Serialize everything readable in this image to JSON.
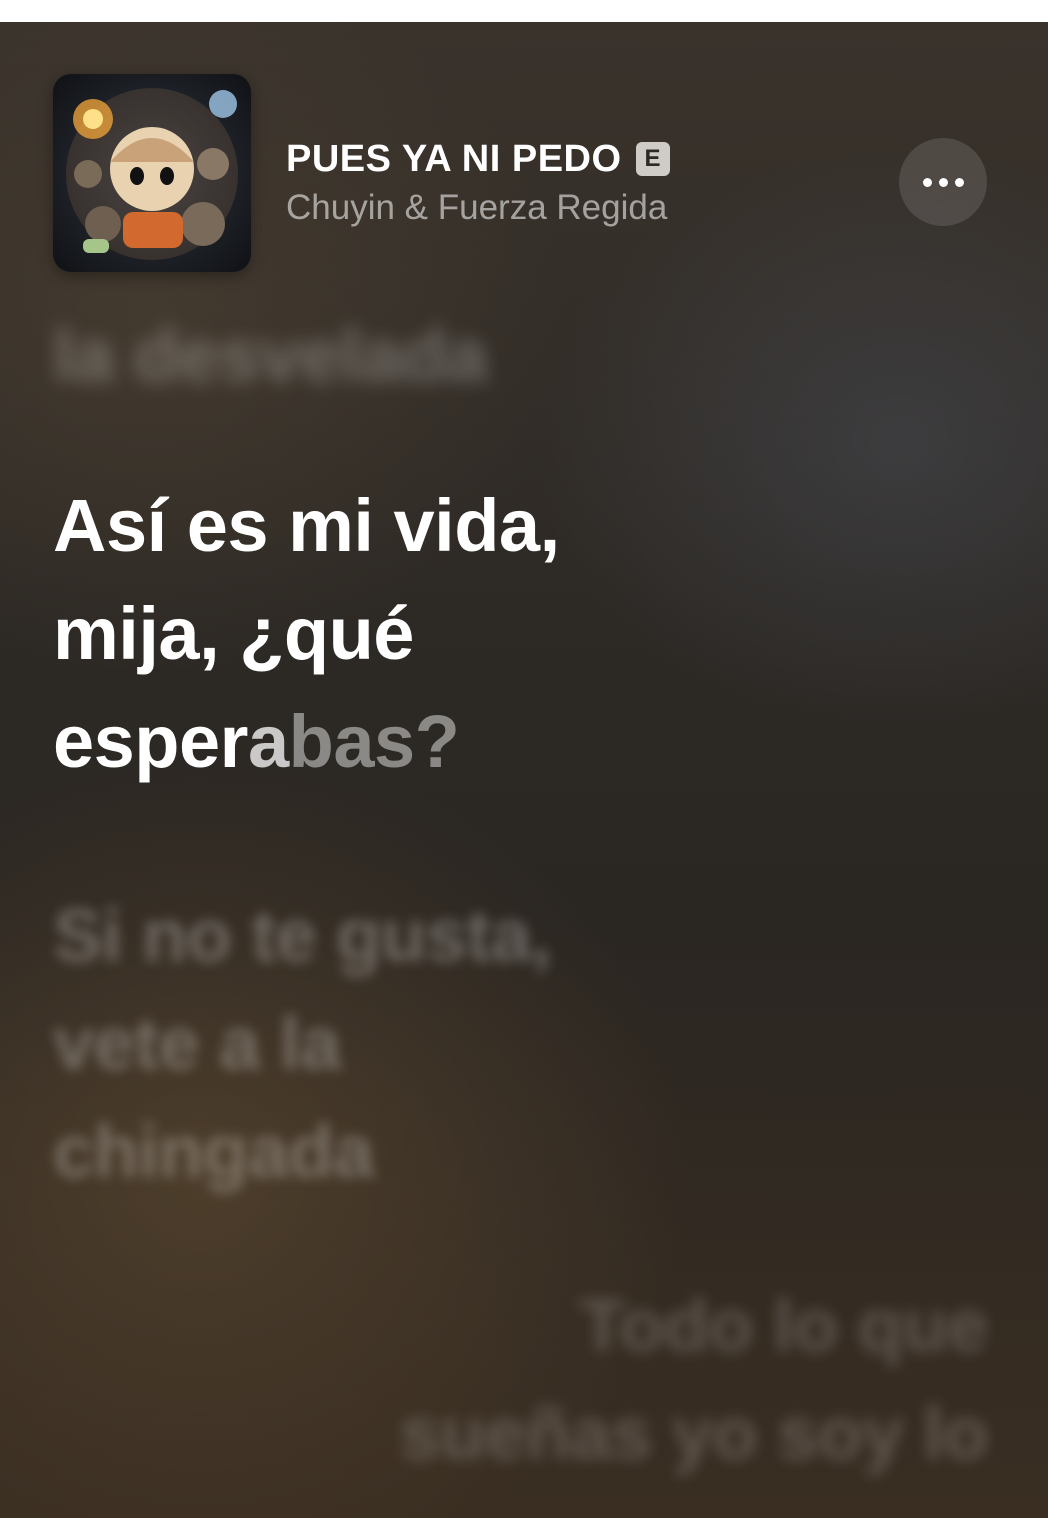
{
  "now_playing": {
    "title": "PUES YA NI PEDO",
    "explicit_badge": "E",
    "artist": "Chuyin & Fuerza Regida",
    "more_icon": "ellipsis-icon"
  },
  "lyrics": {
    "previous_line": "la desvelada",
    "current": {
      "line1": "Así es mi vida,",
      "line2": "mija, ¿qué",
      "line3_sung": "esper",
      "line3_partial": "a",
      "line3_unsung": "bas?"
    },
    "next": {
      "line1": "Si no te gusta,",
      "line2": "vete a la",
      "line3": "chingada"
    },
    "background_vocal": {
      "line1": "Todo lo que",
      "line2": "sueñas yo soy lo"
    }
  }
}
